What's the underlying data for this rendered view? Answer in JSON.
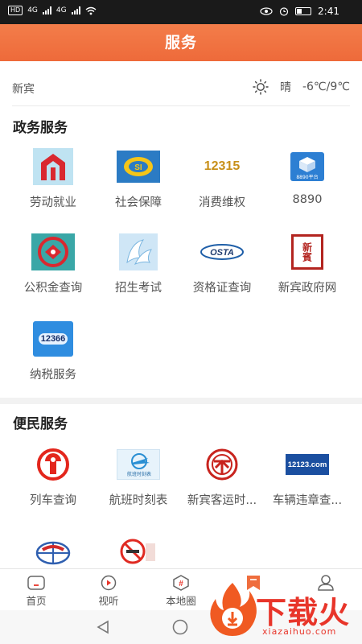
{
  "status_bar": {
    "hd": "HD",
    "net1": "4G",
    "net2": "4G",
    "time": "2:41"
  },
  "header": {
    "title": "服务"
  },
  "weather": {
    "city": "新宾",
    "condition": "晴",
    "temperature": "-6℃/9℃"
  },
  "sections": [
    {
      "title": "政务服务",
      "items": [
        {
          "label": "劳动就业",
          "icon": "labor-employment-icon"
        },
        {
          "label": "社会保障",
          "icon": "social-security-icon"
        },
        {
          "label": "消费维权",
          "icon": "consumer-rights-12315-icon",
          "icon_text": "12315"
        },
        {
          "label": "8890",
          "icon": "8890-platform-icon",
          "icon_text": "8890平台"
        },
        {
          "label": "公积金查询",
          "icon": "housing-fund-icon"
        },
        {
          "label": "招生考试",
          "icon": "enrollment-exam-icon"
        },
        {
          "label": "资格证查询",
          "icon": "osta-icon",
          "icon_text": "OSTA"
        },
        {
          "label": "新宾政府网",
          "icon": "xinbin-gov-icon",
          "icon_text": "新賓"
        },
        {
          "label": "纳税服务",
          "icon": "tax-service-icon",
          "icon_text": "12366"
        }
      ]
    },
    {
      "title": "便民服务",
      "items": [
        {
          "label": "列车查询",
          "icon": "railway-icon"
        },
        {
          "label": "航班时刻表",
          "icon": "flight-schedule-icon",
          "icon_text": "航班时刻表"
        },
        {
          "label": "新宾客运时...",
          "icon": "bus-transport-icon"
        },
        {
          "label": "车辆违章查...",
          "icon": "vehicle-violation-12123-icon",
          "icon_text": "12123.com"
        },
        {
          "label": "",
          "icon": "globe-logo-icon"
        },
        {
          "label": "",
          "icon": "no-smoking-icon"
        }
      ]
    }
  ],
  "tabbar": [
    {
      "label": "首页",
      "icon": "home-icon"
    },
    {
      "label": "视听",
      "icon": "play-icon"
    },
    {
      "label": "本地圈",
      "icon": "hashtag-icon"
    },
    {
      "label": "",
      "icon": "bookmark-icon",
      "active": true
    },
    {
      "label": "",
      "icon": "user-icon"
    }
  ],
  "watermark": {
    "text": "下载火",
    "url": "xiazaihuo.com"
  },
  "colors": {
    "accent": "#ef6d3d",
    "brand_red": "#e8352a"
  }
}
